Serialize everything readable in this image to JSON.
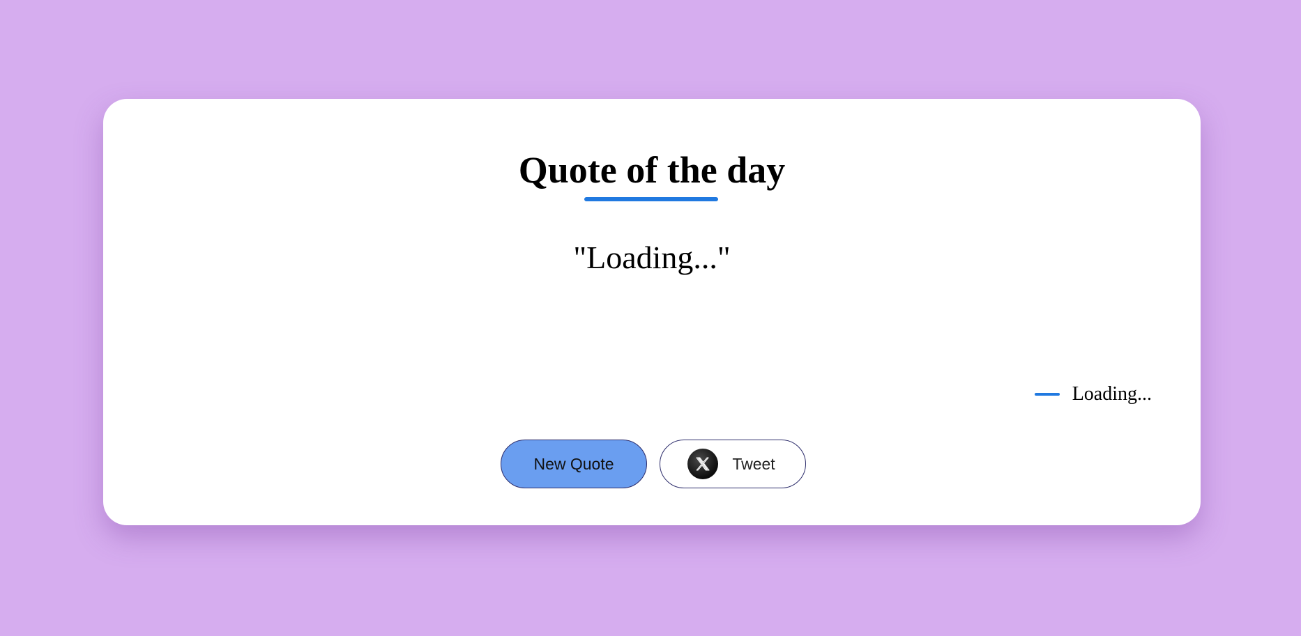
{
  "page": {
    "background": "#d6adef",
    "accent": "#2079e0"
  },
  "card": {
    "title": "Quote of the day",
    "quote": "\"Loading...\"",
    "author": "Loading..."
  },
  "buttons": {
    "new_quote_label": "New Quote",
    "new_quote_color": "#6a9ef0",
    "tweet_label": "Tweet",
    "tweet_icon": "x-logo-icon"
  }
}
